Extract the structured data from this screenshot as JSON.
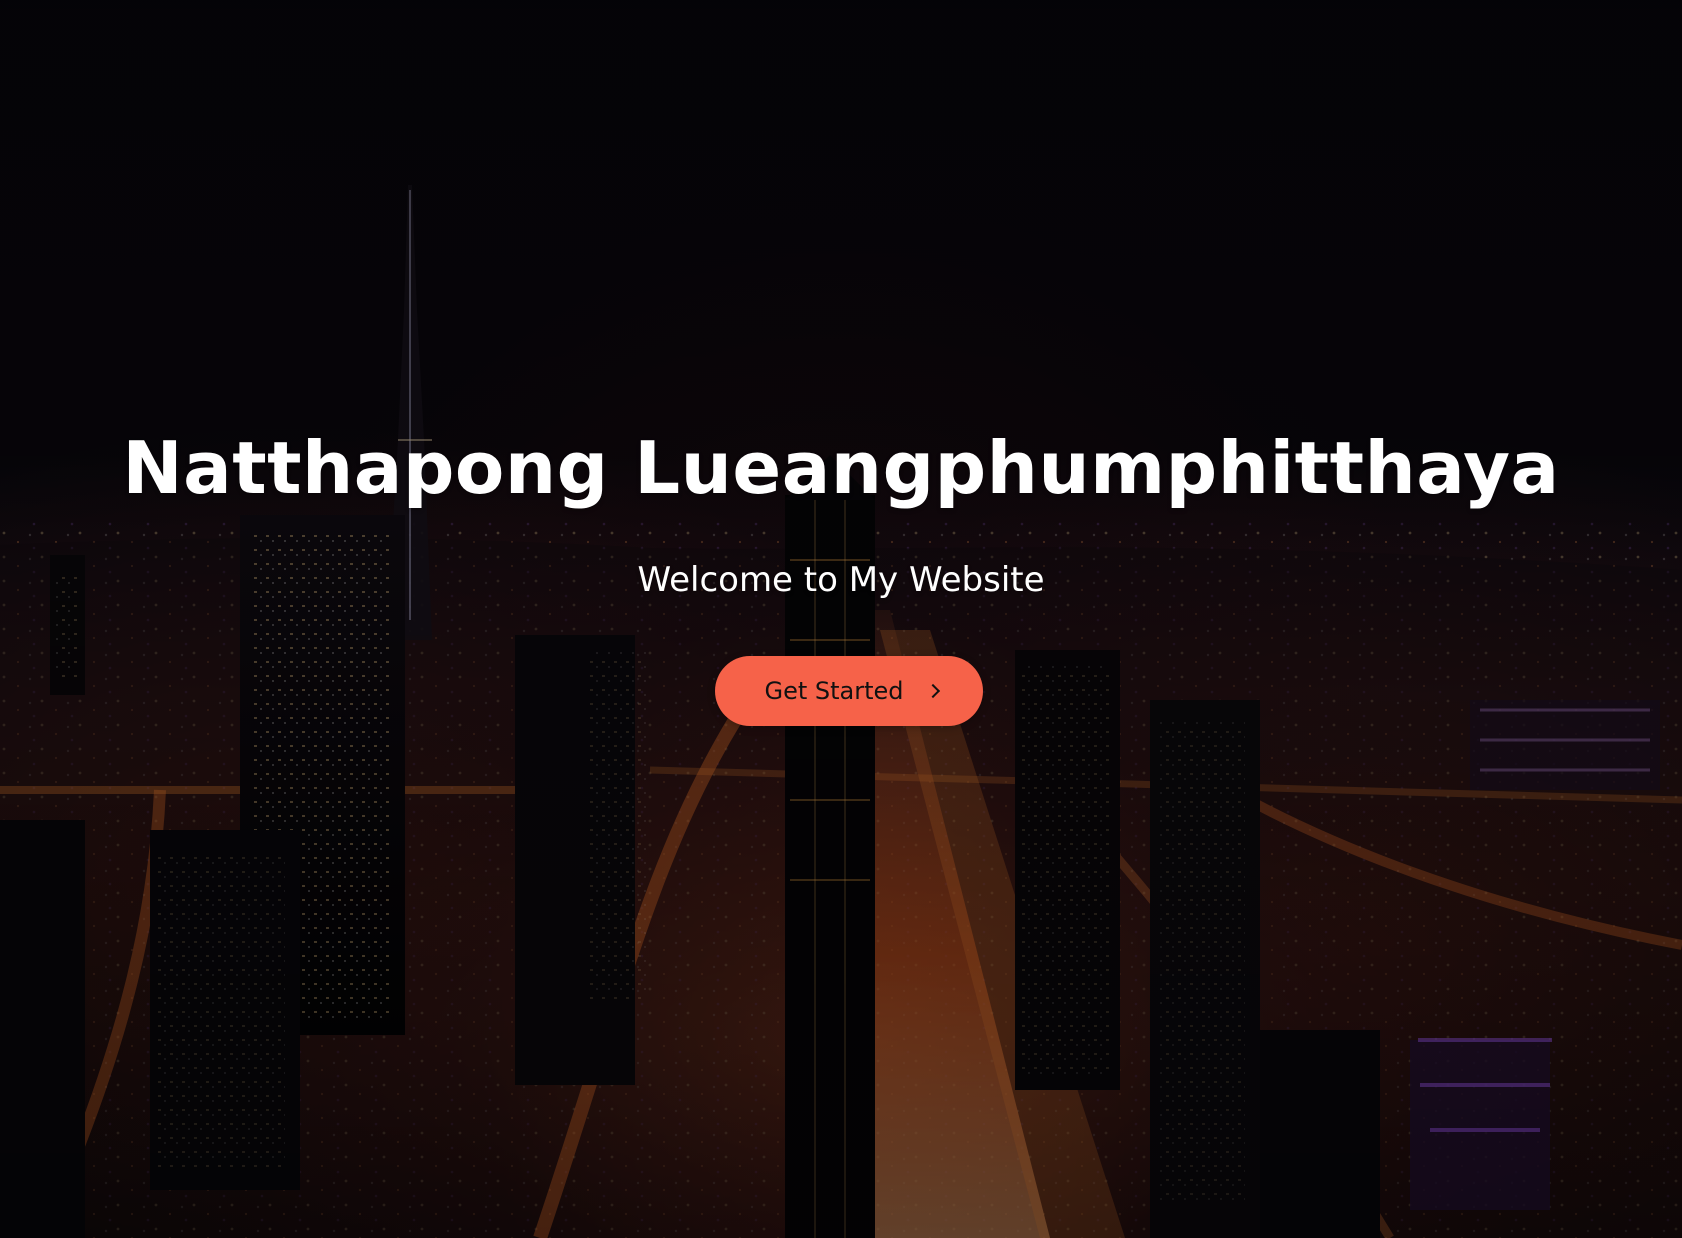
{
  "hero": {
    "title": "Natthapong Lueangphumphitthaya",
    "subtitle": "Welcome to My Website",
    "background_image": "night city skyline",
    "button": {
      "label": "Get Started",
      "icon": "chevron-right-icon",
      "color": "#f66249"
    }
  },
  "colors": {
    "text": "#ffffff",
    "button_text": "#111111",
    "accent": "#f66249"
  }
}
